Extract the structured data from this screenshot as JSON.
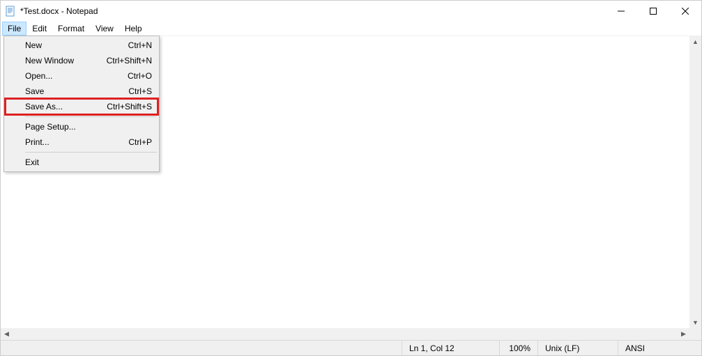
{
  "title": "*Test.docx - Notepad",
  "menubar": [
    "File",
    "Edit",
    "Format",
    "View",
    "Help"
  ],
  "active_menu_index": 0,
  "file_menu": {
    "groups": [
      [
        {
          "label": "New",
          "shortcut": "Ctrl+N"
        },
        {
          "label": "New Window",
          "shortcut": "Ctrl+Shift+N"
        },
        {
          "label": "Open...",
          "shortcut": "Ctrl+O"
        },
        {
          "label": "Save",
          "shortcut": "Ctrl+S"
        },
        {
          "label": "Save As...",
          "shortcut": "Ctrl+Shift+S",
          "highlighted": true
        }
      ],
      [
        {
          "label": "Page Setup...",
          "shortcut": ""
        },
        {
          "label": "Print...",
          "shortcut": "Ctrl+P"
        }
      ],
      [
        {
          "label": "Exit",
          "shortcut": ""
        }
      ]
    ]
  },
  "status": {
    "position": "Ln 1, Col 12",
    "zoom": "100%",
    "line_ending": "Unix (LF)",
    "encoding": "ANSI"
  }
}
